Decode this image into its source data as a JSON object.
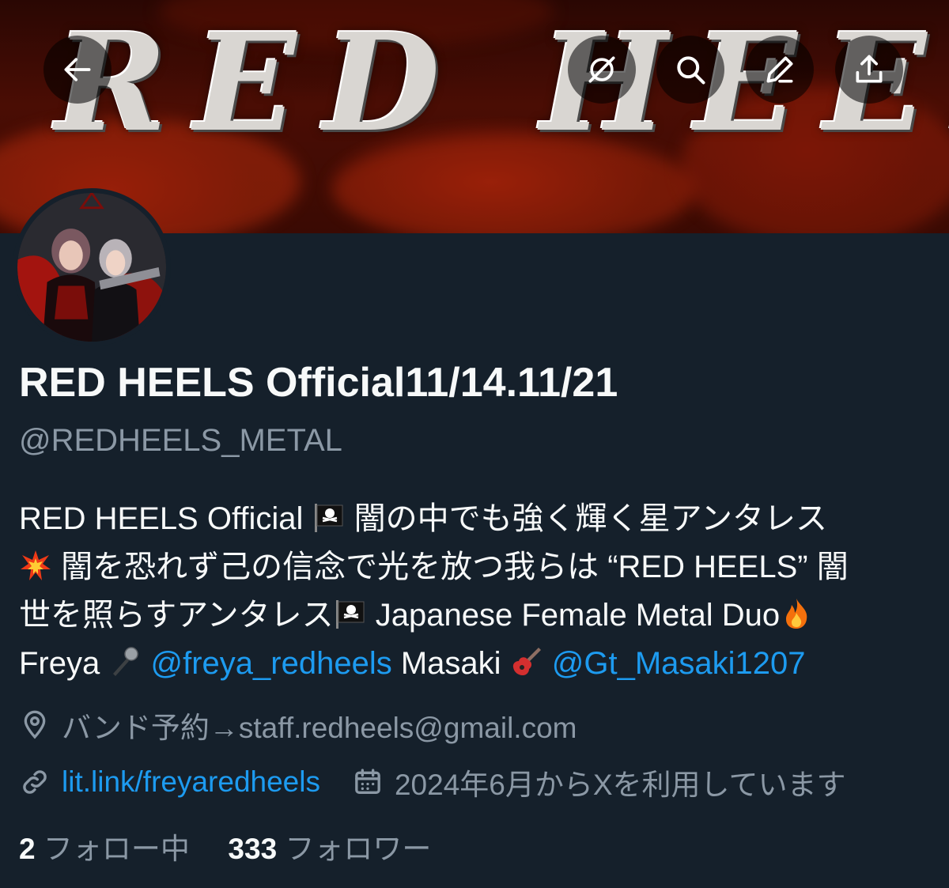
{
  "banner": {
    "logo_text": "RED HEELS"
  },
  "nav": {
    "back": "back-arrow-icon",
    "grok": "grok-slash-icon",
    "search": "search-icon",
    "edit": "edit-icon",
    "share": "share-icon"
  },
  "profile": {
    "name": "RED HEELS Official11/14.11/21",
    "handle": "@REDHEELS_METAL",
    "bio": {
      "line1_a": "RED HEELS Official ",
      "line1_b": " 闇の中でも強く輝く星アンタレス",
      "line2": " 闇を恐れず己の信念で光を放つ我らは “RED HEELS” 闇",
      "line3_a": "世を照らすアンタレス",
      "line3_b": " Japanese Female Metal Duo",
      "line4_a": "Freya ",
      "mention1": "@freya_redheels",
      "line4_b": " Masaki ",
      "mention2": "@Gt_Masaki1207"
    },
    "location": "バンド予約→staff.redheels@gmail.com",
    "website": "lit.link/freyaredheels",
    "joined": "2024年6月からXを利用しています"
  },
  "stats": {
    "following_count": "2",
    "following_label": "フォロー中",
    "followers_count": "333",
    "followers_label": "フォロワー"
  },
  "colors": {
    "background": "#15202b",
    "text": "#f7f9f9",
    "secondary": "#8b98a5",
    "link": "#1d9bf0"
  }
}
